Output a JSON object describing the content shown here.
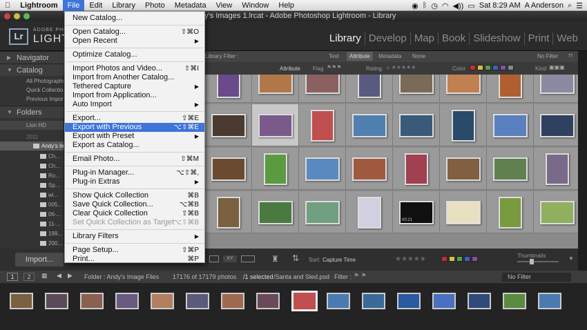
{
  "menubar": {
    "app": "Lightroom",
    "items": [
      "File",
      "Edit",
      "Library",
      "Photo",
      "Metadata",
      "View",
      "Window",
      "Help"
    ],
    "clock": "Sat 8:29 AM",
    "user": "A Anderson"
  },
  "window_title": "Andy's Images 1.lrcat - Adobe Photoshop Lightroom - Library",
  "brand": {
    "logo": "Lr",
    "line1": "ADOBE PHOTOSHOP",
    "line2": "LIGHTROOM"
  },
  "modules": [
    "Library",
    "Develop",
    "Map",
    "Book",
    "Slideshow",
    "Print",
    "Web"
  ],
  "left_panel": {
    "navigator": "Navigator",
    "catalog": "Catalog",
    "catalog_items": [
      "All Photographs",
      "Quick Collection",
      "Previous Import"
    ],
    "folders": "Folders",
    "volume": "Lion HD",
    "folder_rows": [
      "2011",
      "Andy's Im...",
      "Ch...",
      "Ch...",
      "Ro...",
      "Sp...",
      "wi...",
      "005...",
      "06-...",
      "11-...",
      "199...",
      "200..."
    ],
    "import_label": "Import..."
  },
  "filter_bar": {
    "label": "Library Filter :",
    "tabs": [
      "Text",
      "Attribute",
      "Metadata",
      "None"
    ],
    "preset": "No Filter"
  },
  "attribute_bar": {
    "attribute": "Attribute",
    "flag": "Flag",
    "rating": "Rating",
    "color": "Color",
    "kind": "Kind",
    "color_swatches": [
      "#c03030",
      "#d8c040",
      "#50a050",
      "#4060b8",
      "#8050a0",
      "#888888"
    ]
  },
  "toolbar": {
    "sort_label": "Sort:",
    "sort_value": "Capture Time",
    "thumbnails": "Thumbnails",
    "color_swatches": [
      "#c03030",
      "#d8c040",
      "#50a050",
      "#4060b8",
      "#8050a0"
    ]
  },
  "filmstrip_bar": {
    "page1": "1",
    "page2": "2",
    "folder": "Folder : Andy's Image Files",
    "count": "17176 of 17179 photos",
    "selected": "/1 selected",
    "file": "/Santa and Sled.psd",
    "filter_label": "Filter :",
    "filter_value": "No Filter"
  },
  "grid_thumbnail_badge": "00:21",
  "file_menu": {
    "items": [
      {
        "label": "New Catalog...",
        "shortcut": ""
      },
      {
        "label": "Open Catalog...",
        "shortcut": "⇧⌘O"
      },
      {
        "label": "Open Recent",
        "shortcut": "▶"
      },
      {
        "label": "Optimize Catalog...",
        "shortcut": ""
      },
      {
        "label": "Import Photos and Video...",
        "shortcut": "⇧⌘I"
      },
      {
        "label": "Import from Another Catalog...",
        "shortcut": ""
      },
      {
        "label": "Tethered Capture",
        "shortcut": "▶"
      },
      {
        "label": "Import from Application...",
        "shortcut": ""
      },
      {
        "label": "Auto Import",
        "shortcut": "▶"
      },
      {
        "label": "Export...",
        "shortcut": "⇧⌘E"
      },
      {
        "label": "Export with Previous",
        "shortcut": "⌥⇧⌘E"
      },
      {
        "label": "Export with Preset",
        "shortcut": "▶"
      },
      {
        "label": "Export as Catalog...",
        "shortcut": ""
      },
      {
        "label": "Email Photo...",
        "shortcut": "⇧⌘M"
      },
      {
        "label": "Plug-in Manager...",
        "shortcut": "⌥⇧⌘,"
      },
      {
        "label": "Plug-in Extras",
        "shortcut": "▶"
      },
      {
        "label": "Show Quick Collection",
        "shortcut": "⌘B"
      },
      {
        "label": "Save Quick Collection...",
        "shortcut": "⌥⌘B"
      },
      {
        "label": "Clear Quick Collection",
        "shortcut": "⇧⌘B"
      },
      {
        "label": "Set Quick Collection as Target",
        "shortcut": "⌥⇧⌘B"
      },
      {
        "label": "Library Filters",
        "shortcut": "▶"
      },
      {
        "label": "Page Setup...",
        "shortcut": "⇧⌘P"
      },
      {
        "label": "Print...",
        "shortcut": "⌘P"
      }
    ]
  }
}
